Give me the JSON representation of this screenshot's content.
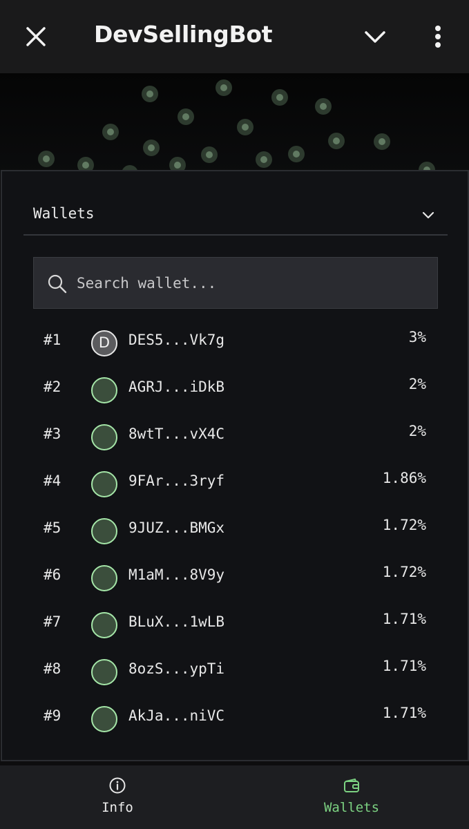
{
  "header": {
    "title": "DevSellingBot",
    "close_icon": "close-icon",
    "collapse_icon": "chevron-down-icon",
    "more_icon": "more-vertical-icon"
  },
  "wallets": {
    "section_label": "Wallets",
    "search_placeholder": "Search wallet...",
    "rows": [
      {
        "rank": "#1",
        "avatar_letter": "D",
        "address": "DES5...Vk7g",
        "percent": "3%"
      },
      {
        "rank": "#2",
        "avatar_letter": "",
        "address": "AGRJ...iDkB",
        "percent": "2%"
      },
      {
        "rank": "#3",
        "avatar_letter": "",
        "address": "8wtT...vX4C",
        "percent": "2%"
      },
      {
        "rank": "#4",
        "avatar_letter": "",
        "address": "9FAr...3ryf",
        "percent": "1.86%"
      },
      {
        "rank": "#5",
        "avatar_letter": "",
        "address": "9JUZ...BMGx",
        "percent": "1.72%"
      },
      {
        "rank": "#6",
        "avatar_letter": "",
        "address": "M1aM...8V9y",
        "percent": "1.72%"
      },
      {
        "rank": "#7",
        "avatar_letter": "",
        "address": "BLuX...1wLB",
        "percent": "1.71%"
      },
      {
        "rank": "#8",
        "avatar_letter": "",
        "address": "8ozS...ypTi",
        "percent": "1.71%"
      },
      {
        "rank": "#9",
        "avatar_letter": "",
        "address": "AkJa...niVC",
        "percent": "1.71%"
      }
    ]
  },
  "bottom_nav": {
    "info_label": "Info",
    "wallets_label": "Wallets",
    "active": "Wallets"
  },
  "colors": {
    "accent_green": "#7cd282",
    "avatar_border": "#a5e6a8",
    "panel_bg": "#111215"
  }
}
